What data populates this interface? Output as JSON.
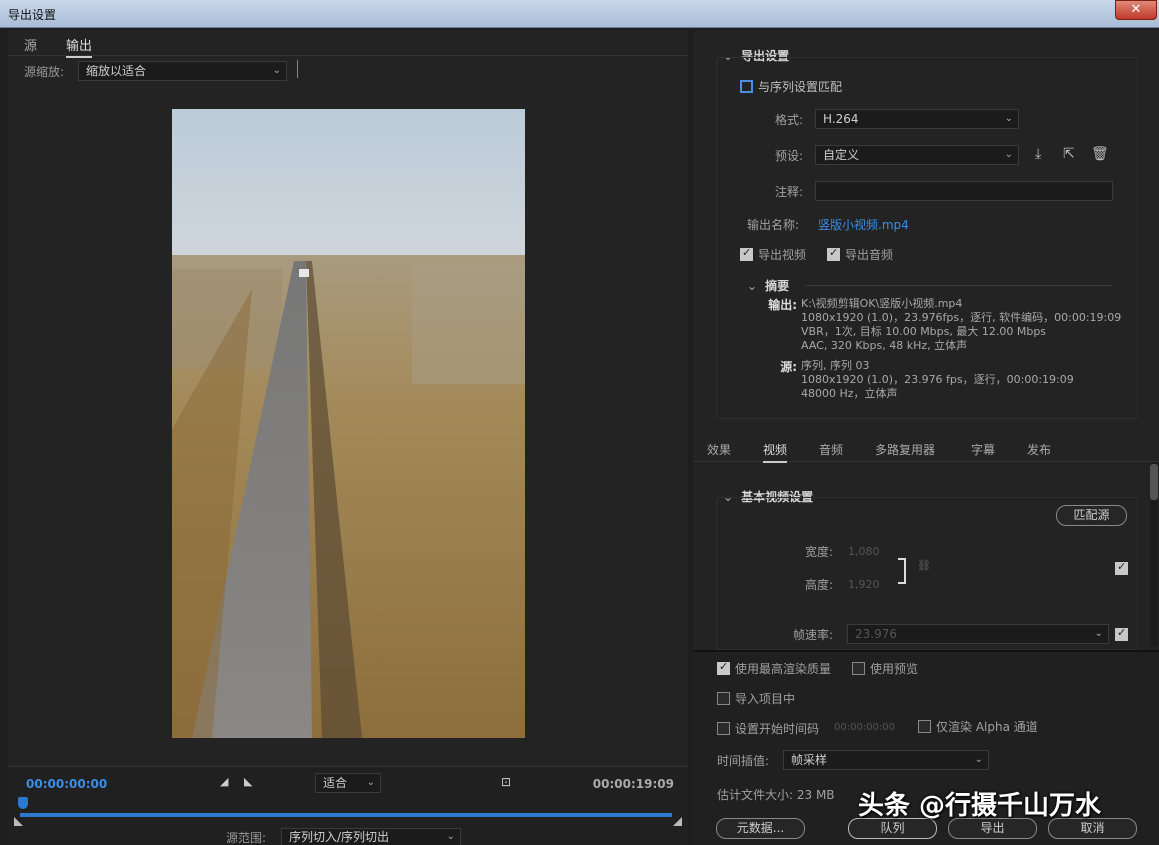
{
  "window": {
    "title": "导出设置",
    "close": "✕"
  },
  "left": {
    "tabs": [
      "源",
      "输出"
    ],
    "source_scale_label": "源缩放:",
    "source_scale_value": "缩放以适合",
    "timecode_start": "00:00:00:00",
    "timecode_end": "00:00:19:09",
    "fit_value": "适合",
    "source_range_label": "源范围:",
    "source_range_value": "序列切入/序列切出"
  },
  "export": {
    "section_title": "导出设置",
    "match_sequence": "与序列设置匹配",
    "format_label": "格式:",
    "format_value": "H.264",
    "preset_label": "预设:",
    "preset_value": "自定义",
    "comment_label": "注释:",
    "output_name_label": "输出名称:",
    "output_name_value": "竖版小视频.mp4",
    "export_video": "导出视频",
    "export_audio": "导出音频",
    "summary_title": "摘要",
    "output_key": "输出:",
    "output_lines": [
      "K:\\视频剪辑OK\\竖版小视频.mp4",
      "1080x1920 (1.0)，23.976fps，逐行, 软件编码，00:00:19:09",
      "VBR，1次, 目标 10.00 Mbps, 最大 12.00 Mbps",
      "AAC, 320 Kbps, 48  kHz, 立体声"
    ],
    "source_key": "源:",
    "source_lines": [
      "序列, 序列 03",
      "1080x1920 (1.0)，23.976 fps，逐行，00:00:19:09",
      "48000 Hz，立体声"
    ]
  },
  "tabs": [
    "效果",
    "视频",
    "音频",
    "多路复用器",
    "字幕",
    "发布"
  ],
  "video": {
    "section_title": "基本视频设置",
    "match_source": "匹配源",
    "width_label": "宽度:",
    "width_value": "1,080",
    "height_label": "高度:",
    "height_value": "1,920",
    "fps_label": "帧速率:",
    "fps_value": "23.976"
  },
  "bottom": {
    "max_quality": "使用最高渲染质量",
    "use_preview": "使用预览",
    "import_project": "导入项目中",
    "set_start_tc": "设置开始时间码",
    "start_tc_value": "00:00:00:00",
    "alpha_only": "仅渲染 Alpha 通道",
    "interp_label": "时间插值:",
    "interp_value": "帧采样",
    "est_size": "估计文件大小: 23 MB",
    "metadata": "元数据...",
    "queue": "队列",
    "export": "导出",
    "cancel": "取消"
  },
  "watermark": "头条 @行摄千山万水"
}
